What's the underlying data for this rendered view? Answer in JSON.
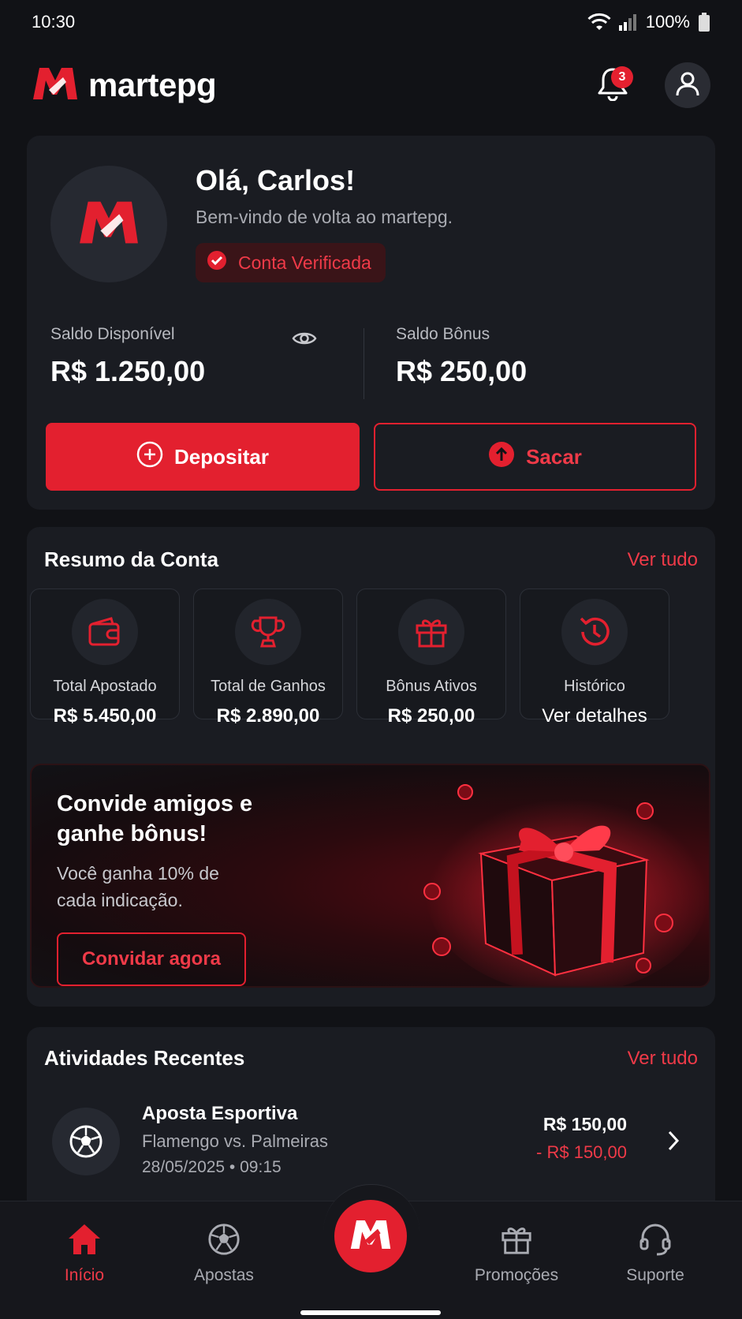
{
  "status_bar": {
    "time": "10:30",
    "battery": "100%"
  },
  "header": {
    "brand_name": "martepg",
    "notification_count": "3"
  },
  "welcome": {
    "greeting": "Olá, Carlos!",
    "subtitle": "Bem-vindo de volta ao martepg.",
    "verified_label": "Conta Verificada"
  },
  "balances": {
    "available_label": "Saldo Disponível",
    "available_value": "R$ 1.250,00",
    "bonus_label": "Saldo Bônus",
    "bonus_value": "R$ 250,00"
  },
  "actions": {
    "deposit": "Depositar",
    "withdraw": "Sacar"
  },
  "summary": {
    "title": "Resumo da Conta",
    "see_all": "Ver tudo",
    "tiles": [
      {
        "label": "Total Apostado",
        "value": "R$ 5.450,00",
        "icon": "wallet-icon"
      },
      {
        "label": "Total de Ganhos",
        "value": "R$ 2.890,00",
        "icon": "trophy-icon"
      },
      {
        "label": "Bônus Ativos",
        "value": "R$ 250,00",
        "icon": "gift-icon"
      },
      {
        "label": "Histórico",
        "value": "Ver detalhes",
        "icon": "history-icon"
      }
    ]
  },
  "promo": {
    "title": "Convide amigos e ganhe bônus!",
    "text": "Você ganha 10% de cada indicação.",
    "button": "Convidar agora"
  },
  "activities": {
    "title": "Atividades Recentes",
    "see_all": "Ver tudo",
    "items": [
      {
        "title": "Aposta Esportiva",
        "subtitle": "Flamengo vs. Palmeiras",
        "date": "28/05/2025 • 09:15",
        "amount": "R$ 150,00",
        "delta": "- R$ 150,00",
        "icon": "soccer-ball-icon"
      }
    ]
  },
  "nav": {
    "items": [
      {
        "label": "Início",
        "icon": "home-icon",
        "active": true
      },
      {
        "label": "Apostas",
        "icon": "soccer-ball-icon",
        "active": false
      },
      {
        "label": "Promoções",
        "icon": "gift-icon",
        "active": false
      },
      {
        "label": "Suporte",
        "icon": "headset-icon",
        "active": false
      }
    ]
  },
  "colors": {
    "accent": "#e3202f",
    "background": "#111216",
    "card": "#1a1c22",
    "muted_text": "#a9abb2"
  }
}
